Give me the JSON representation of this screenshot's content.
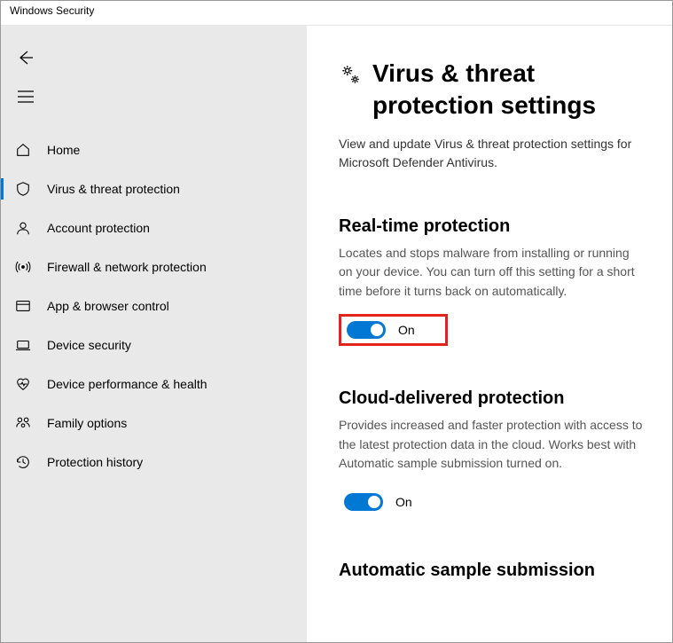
{
  "window": {
    "title": "Windows Security"
  },
  "sidebar": {
    "items": [
      {
        "label": "Home"
      },
      {
        "label": "Virus & threat protection"
      },
      {
        "label": "Account protection"
      },
      {
        "label": "Firewall & network protection"
      },
      {
        "label": "App & browser control"
      },
      {
        "label": "Device security"
      },
      {
        "label": "Device performance & health"
      },
      {
        "label": "Family options"
      },
      {
        "label": "Protection history"
      }
    ]
  },
  "page": {
    "title": "Virus & threat protection settings",
    "subtitle": "View and update Virus & threat protection settings for Microsoft Defender Antivirus."
  },
  "sections": {
    "realtime": {
      "title": "Real-time protection",
      "desc": "Locates and stops malware from installing or running on your device. You can turn off this setting for a short time before it turns back on automatically.",
      "state": "On"
    },
    "cloud": {
      "title": "Cloud-delivered protection",
      "desc": "Provides increased and faster protection with access to the latest protection data in the cloud. Works best with Automatic sample submission turned on.",
      "state": "On"
    },
    "sample": {
      "title": "Automatic sample submission"
    }
  }
}
